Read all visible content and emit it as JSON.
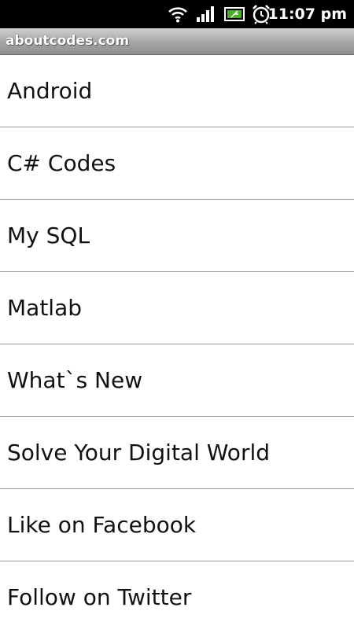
{
  "status_bar": {
    "time": "11:07 pm",
    "icons": [
      "wifi-icon",
      "signal-icon",
      "battery-icon",
      "alarm-clock-icon"
    ]
  },
  "title_bar": {
    "title": "aboutcodes.com"
  },
  "menu": {
    "items": [
      {
        "label": "Android"
      },
      {
        "label": "C# Codes"
      },
      {
        "label": "My SQL"
      },
      {
        "label": "Matlab"
      },
      {
        "label": "What`s New"
      },
      {
        "label": "Solve Your Digital World"
      },
      {
        "label": "Like on Facebook"
      },
      {
        "label": "Follow on Twitter"
      }
    ]
  },
  "colors": {
    "status_bar_bg": "#000000",
    "title_bar_bg": "#a8a8a8",
    "list_bg": "#ffffff",
    "divider": "#9a9a9a",
    "battery_fill": "#4caf2a"
  }
}
